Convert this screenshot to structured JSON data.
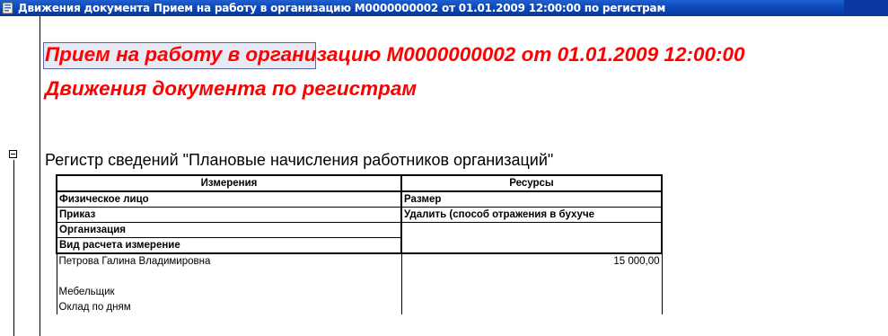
{
  "window": {
    "title": "Движения документа Прием на работу в организацию М0000000002 от 01.01.2009 12:00:00 по регистрам"
  },
  "document": {
    "title": "Прием на работу в организацию М0000000002 от 01.01.2009 12:00:00",
    "subtitle": "Движения документа по регистрам"
  },
  "register": {
    "title": "Регистр сведений \"Плановые начисления работников организаций\"",
    "headers": {
      "dimensions": "Измерения",
      "resources": "Ресурсы"
    },
    "field_rows": [
      {
        "dimension": "Физическое лицо",
        "resource": "Размер"
      },
      {
        "dimension": "Приказ",
        "resource": "Удалить (способ отражения в бухуче"
      },
      {
        "dimension": "Организация",
        "resource": ""
      },
      {
        "dimension": "Вид расчета измерение",
        "resource": ""
      }
    ],
    "data_rows": [
      {
        "dimension": "Петрова Галина Владимировна",
        "resource": "15 000,00"
      },
      {
        "dimension": "",
        "resource": ""
      },
      {
        "dimension": "Мебельщик",
        "resource": ""
      },
      {
        "dimension": "Оклад по дням",
        "resource": ""
      }
    ]
  },
  "colors": {
    "title_red": "#ff0000",
    "titlebar_blue": "#0a47b8"
  },
  "icons": {
    "window_icon": "document-register-icon",
    "collapse": "collapse-minus-icon"
  }
}
